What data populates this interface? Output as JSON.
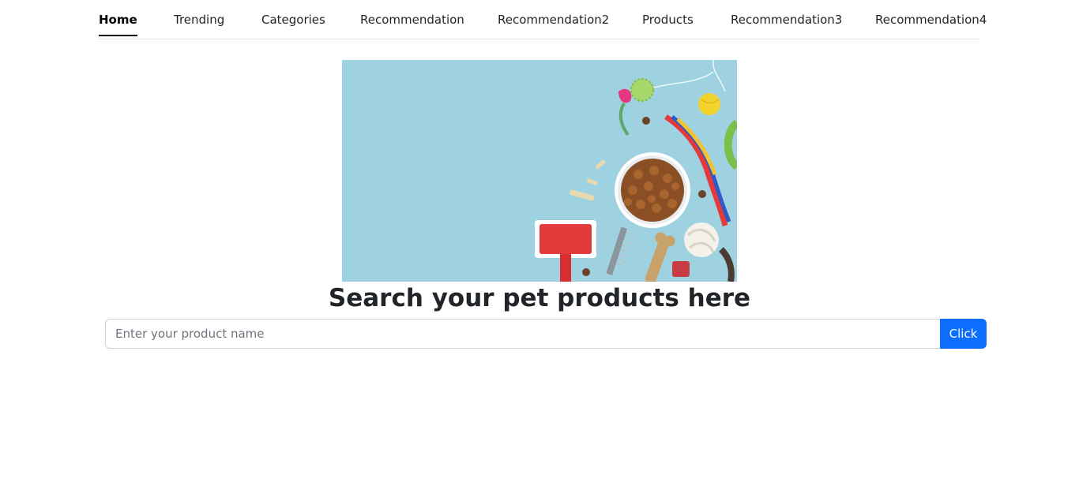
{
  "nav": {
    "items": [
      {
        "label": "Home",
        "active": true
      },
      {
        "label": "Trending",
        "active": false
      },
      {
        "label": "Categories",
        "active": false
      },
      {
        "label": "Recommendation",
        "active": false
      },
      {
        "label": "Recommendation2",
        "active": false
      },
      {
        "label": "Products",
        "active": false
      },
      {
        "label": "Recommendation3",
        "active": false
      },
      {
        "label": "Recommendation4",
        "active": false
      }
    ]
  },
  "hero": {
    "image": "pet-products-banner",
    "background_color": "#9fd2e1"
  },
  "search": {
    "heading": "Search your pet products here",
    "placeholder": "Enter your product name",
    "value": "",
    "button_label": "Click",
    "button_color": "#0d6efd"
  }
}
